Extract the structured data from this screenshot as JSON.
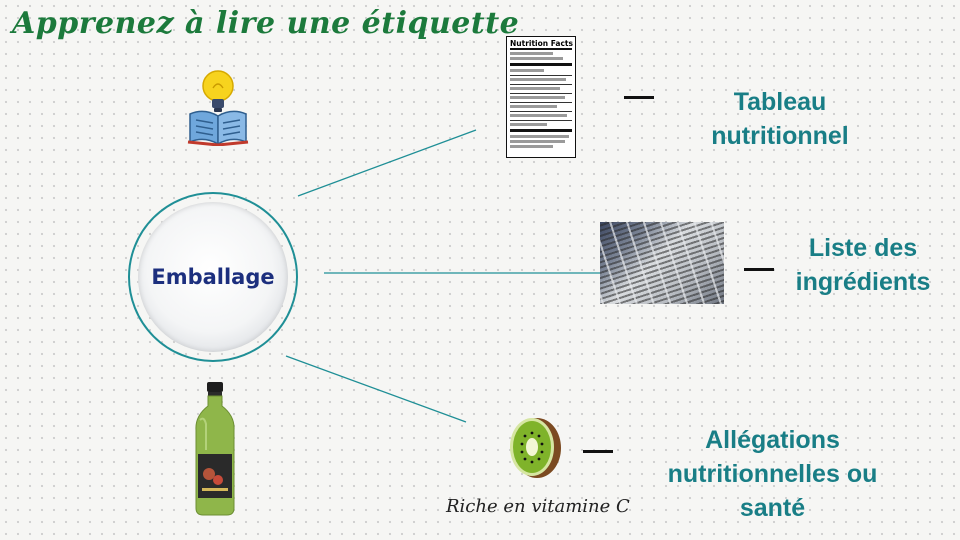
{
  "title": "Apprenez à lire une étiquette",
  "hub": {
    "label": "Emballage"
  },
  "branches": [
    {
      "label": "Tableau nutritionnel",
      "image": "nutrition-facts-label"
    },
    {
      "label": "Liste des ingrédients",
      "image": "ingredients-list-photo"
    },
    {
      "label": "Allégations nutritionnelles ou santé",
      "image": "kiwi",
      "caption": "Riche en vitamine C"
    }
  ],
  "nutrition_facts": {
    "heading": "Nutrition Facts"
  },
  "colors": {
    "title": "#1c7a3c",
    "hub_text": "#1c2f7e",
    "branch_text": "#197e86",
    "connector": "#1f8f96",
    "background": "#f6f6f4"
  },
  "icons": [
    "lightbulb-book-icon",
    "juice-bottle-icon",
    "kiwi-icon"
  ]
}
